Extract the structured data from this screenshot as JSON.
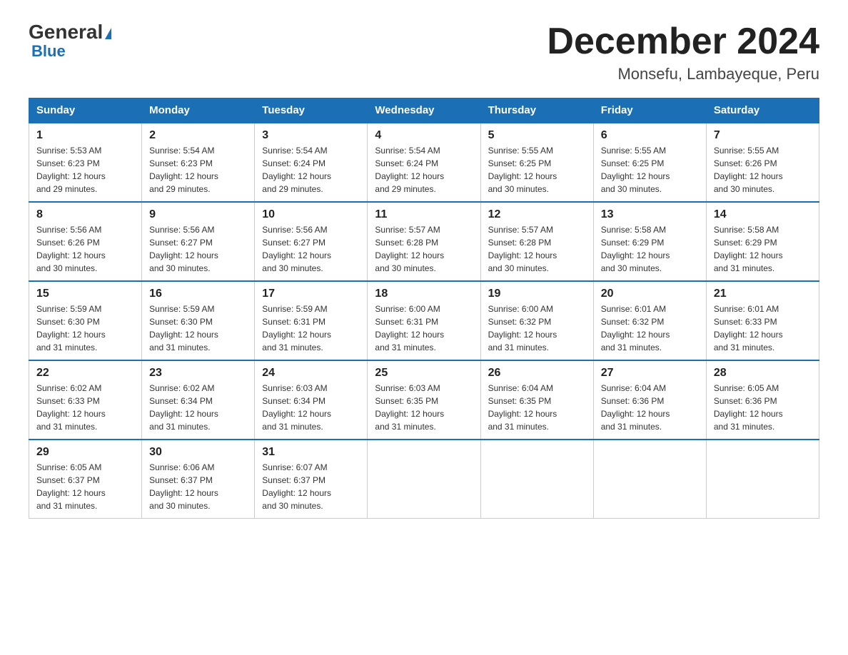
{
  "logo": {
    "general": "General",
    "blue": "Blue",
    "triangle": "▶"
  },
  "title": "December 2024",
  "subtitle": "Monsefu, Lambayeque, Peru",
  "days_of_week": [
    "Sunday",
    "Monday",
    "Tuesday",
    "Wednesday",
    "Thursday",
    "Friday",
    "Saturday"
  ],
  "weeks": [
    [
      {
        "day": "1",
        "sunrise": "5:53 AM",
        "sunset": "6:23 PM",
        "daylight": "12 hours and 29 minutes."
      },
      {
        "day": "2",
        "sunrise": "5:54 AM",
        "sunset": "6:23 PM",
        "daylight": "12 hours and 29 minutes."
      },
      {
        "day": "3",
        "sunrise": "5:54 AM",
        "sunset": "6:24 PM",
        "daylight": "12 hours and 29 minutes."
      },
      {
        "day": "4",
        "sunrise": "5:54 AM",
        "sunset": "6:24 PM",
        "daylight": "12 hours and 29 minutes."
      },
      {
        "day": "5",
        "sunrise": "5:55 AM",
        "sunset": "6:25 PM",
        "daylight": "12 hours and 30 minutes."
      },
      {
        "day": "6",
        "sunrise": "5:55 AM",
        "sunset": "6:25 PM",
        "daylight": "12 hours and 30 minutes."
      },
      {
        "day": "7",
        "sunrise": "5:55 AM",
        "sunset": "6:26 PM",
        "daylight": "12 hours and 30 minutes."
      }
    ],
    [
      {
        "day": "8",
        "sunrise": "5:56 AM",
        "sunset": "6:26 PM",
        "daylight": "12 hours and 30 minutes."
      },
      {
        "day": "9",
        "sunrise": "5:56 AM",
        "sunset": "6:27 PM",
        "daylight": "12 hours and 30 minutes."
      },
      {
        "day": "10",
        "sunrise": "5:56 AM",
        "sunset": "6:27 PM",
        "daylight": "12 hours and 30 minutes."
      },
      {
        "day": "11",
        "sunrise": "5:57 AM",
        "sunset": "6:28 PM",
        "daylight": "12 hours and 30 minutes."
      },
      {
        "day": "12",
        "sunrise": "5:57 AM",
        "sunset": "6:28 PM",
        "daylight": "12 hours and 30 minutes."
      },
      {
        "day": "13",
        "sunrise": "5:58 AM",
        "sunset": "6:29 PM",
        "daylight": "12 hours and 30 minutes."
      },
      {
        "day": "14",
        "sunrise": "5:58 AM",
        "sunset": "6:29 PM",
        "daylight": "12 hours and 31 minutes."
      }
    ],
    [
      {
        "day": "15",
        "sunrise": "5:59 AM",
        "sunset": "6:30 PM",
        "daylight": "12 hours and 31 minutes."
      },
      {
        "day": "16",
        "sunrise": "5:59 AM",
        "sunset": "6:30 PM",
        "daylight": "12 hours and 31 minutes."
      },
      {
        "day": "17",
        "sunrise": "5:59 AM",
        "sunset": "6:31 PM",
        "daylight": "12 hours and 31 minutes."
      },
      {
        "day": "18",
        "sunrise": "6:00 AM",
        "sunset": "6:31 PM",
        "daylight": "12 hours and 31 minutes."
      },
      {
        "day": "19",
        "sunrise": "6:00 AM",
        "sunset": "6:32 PM",
        "daylight": "12 hours and 31 minutes."
      },
      {
        "day": "20",
        "sunrise": "6:01 AM",
        "sunset": "6:32 PM",
        "daylight": "12 hours and 31 minutes."
      },
      {
        "day": "21",
        "sunrise": "6:01 AM",
        "sunset": "6:33 PM",
        "daylight": "12 hours and 31 minutes."
      }
    ],
    [
      {
        "day": "22",
        "sunrise": "6:02 AM",
        "sunset": "6:33 PM",
        "daylight": "12 hours and 31 minutes."
      },
      {
        "day": "23",
        "sunrise": "6:02 AM",
        "sunset": "6:34 PM",
        "daylight": "12 hours and 31 minutes."
      },
      {
        "day": "24",
        "sunrise": "6:03 AM",
        "sunset": "6:34 PM",
        "daylight": "12 hours and 31 minutes."
      },
      {
        "day": "25",
        "sunrise": "6:03 AM",
        "sunset": "6:35 PM",
        "daylight": "12 hours and 31 minutes."
      },
      {
        "day": "26",
        "sunrise": "6:04 AM",
        "sunset": "6:35 PM",
        "daylight": "12 hours and 31 minutes."
      },
      {
        "day": "27",
        "sunrise": "6:04 AM",
        "sunset": "6:36 PM",
        "daylight": "12 hours and 31 minutes."
      },
      {
        "day": "28",
        "sunrise": "6:05 AM",
        "sunset": "6:36 PM",
        "daylight": "12 hours and 31 minutes."
      }
    ],
    [
      {
        "day": "29",
        "sunrise": "6:05 AM",
        "sunset": "6:37 PM",
        "daylight": "12 hours and 31 minutes."
      },
      {
        "day": "30",
        "sunrise": "6:06 AM",
        "sunset": "6:37 PM",
        "daylight": "12 hours and 30 minutes."
      },
      {
        "day": "31",
        "sunrise": "6:07 AM",
        "sunset": "6:37 PM",
        "daylight": "12 hours and 30 minutes."
      },
      null,
      null,
      null,
      null
    ]
  ],
  "labels": {
    "sunrise": "Sunrise:",
    "sunset": "Sunset:",
    "daylight": "Daylight:"
  }
}
